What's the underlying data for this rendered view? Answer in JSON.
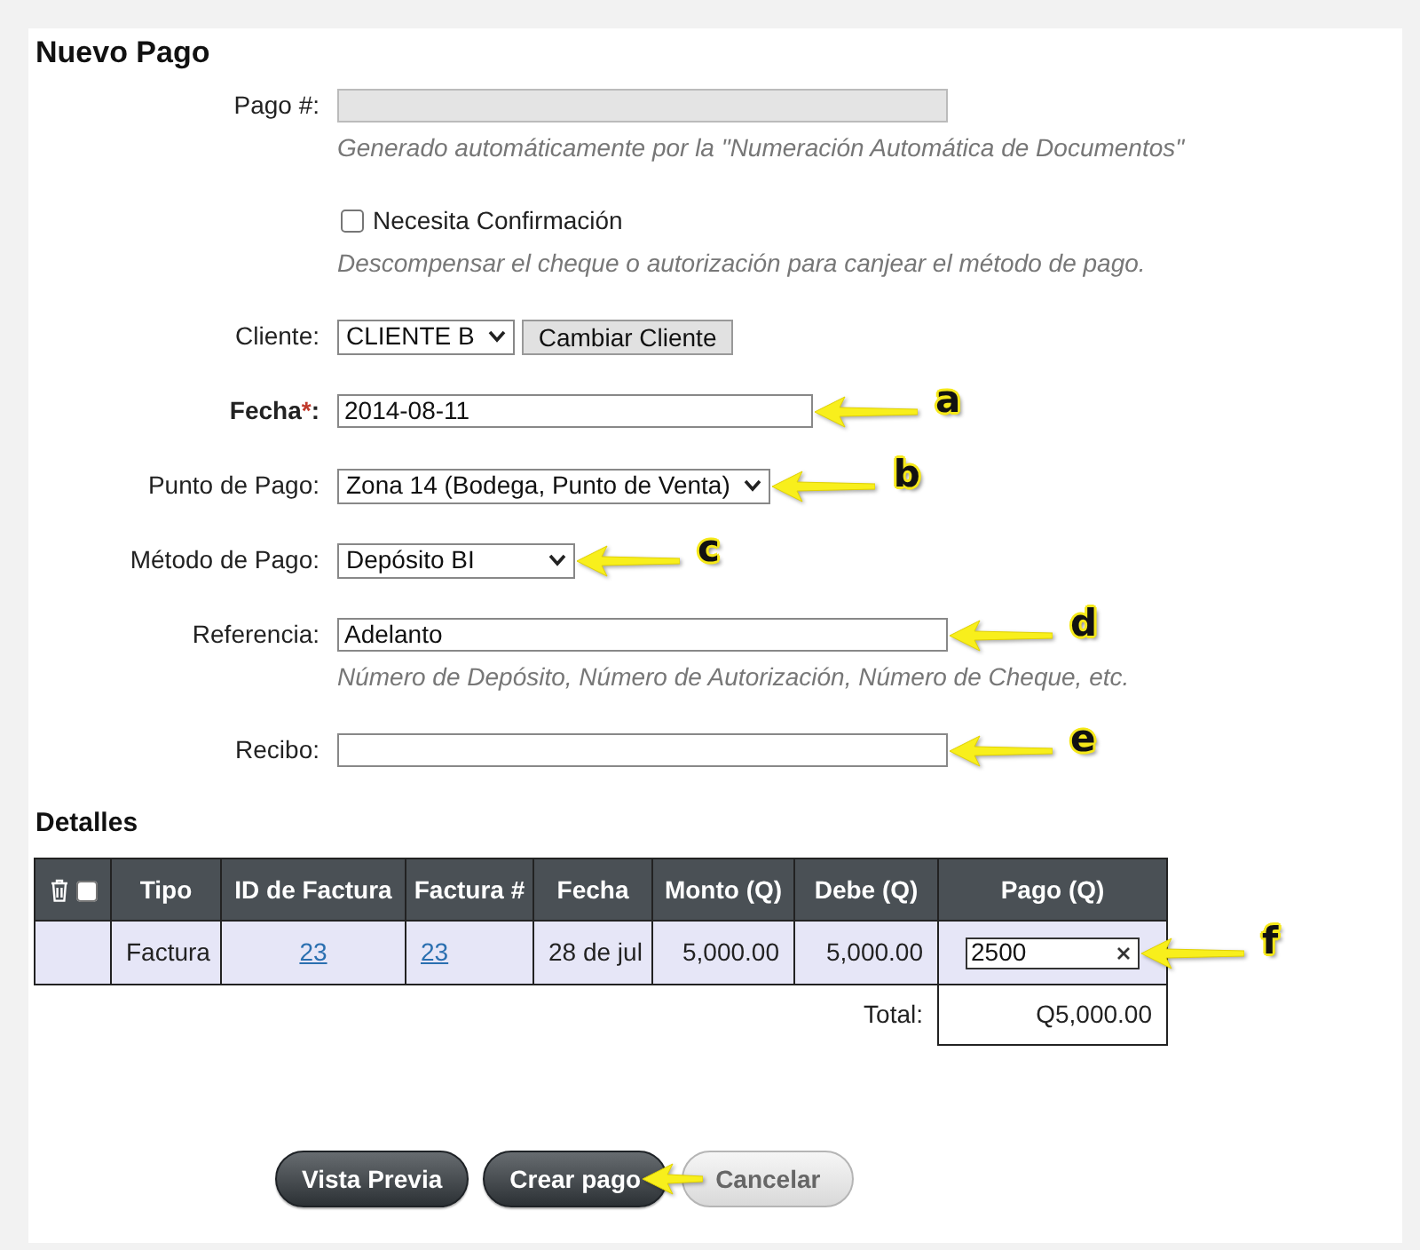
{
  "title": "Nuevo Pago",
  "fields": [
    {
      "kind": "readonly",
      "label": "Pago #:",
      "help": "Generado automáticamente por la \"Numeración Automática de Documentos\""
    },
    {
      "kind": "checkbox",
      "label": "Necesita Confirmación",
      "checked": false,
      "help": "Descompensar el cheque o autorización para canjear el método de pago."
    },
    {
      "kind": "client",
      "label": "Cliente:",
      "value": "CLIENTE B",
      "button": "Cambiar Cliente"
    },
    {
      "kind": "date",
      "label": "Fecha",
      "required_mark": "*",
      "label_end": ":",
      "value": "2014-08-11",
      "callout": "a"
    },
    {
      "kind": "select",
      "label": "Punto de Pago:",
      "value": "Zona 14 (Bodega, Punto de Venta)",
      "callout": "b"
    },
    {
      "kind": "select",
      "label": "Método de Pago:",
      "value": "Depósito BI",
      "callout": "c"
    },
    {
      "kind": "text",
      "label": "Referencia:",
      "value": "Adelanto",
      "help": "Número de Depósito, Número de Autorización, Número de Cheque, etc.",
      "callout": "d"
    },
    {
      "kind": "text",
      "label": "Recibo:",
      "callout": "e"
    }
  ],
  "details": {
    "title": "Detalles",
    "select_all": {
      "checked": false
    },
    "columns": [
      "Tipo",
      "ID de Factura",
      "Factura #",
      "Fecha",
      "Monto (Q)",
      "Debe (Q)",
      "Pago (Q)"
    ],
    "rows": [
      {
        "cells": [
          {
            "kind": "text",
            "text": "Factura"
          },
          {
            "kind": "link",
            "text": "23"
          },
          {
            "kind": "link",
            "text": "23"
          },
          {
            "kind": "text",
            "text": "28 de jul"
          },
          {
            "kind": "text",
            "text": "5,000.00"
          },
          {
            "kind": "text",
            "text": "5,000.00"
          },
          {
            "kind": "input",
            "value": "2500",
            "callout": "f"
          }
        ]
      }
    ],
    "total_label": "Total:",
    "total": "Q5,000.00"
  },
  "buttons": [
    {
      "kind": "primary",
      "label": "Vista Previa",
      "arrow": false
    },
    {
      "kind": "primary",
      "label": "Crear pago",
      "arrow": true
    },
    {
      "kind": "secondary",
      "label": "Cancelar",
      "arrow": false
    }
  ]
}
